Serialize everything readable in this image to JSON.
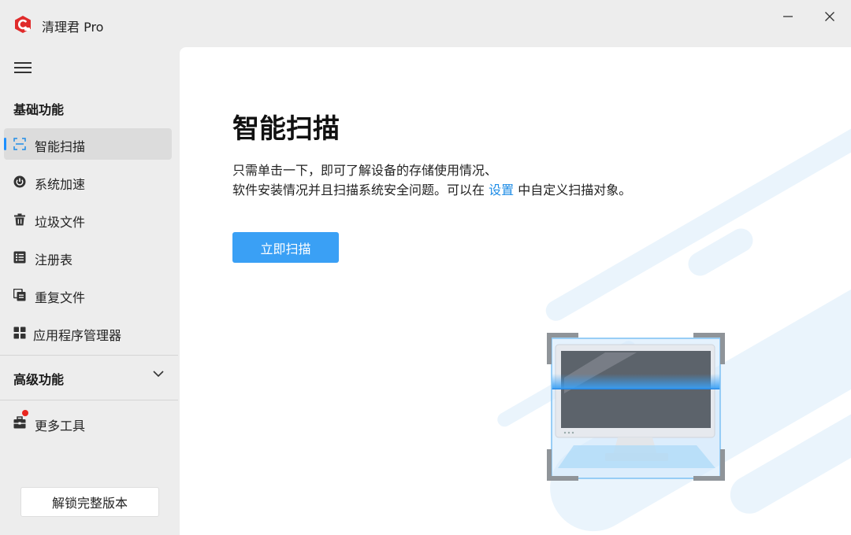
{
  "app": {
    "title": "清理君 Pro",
    "window_controls": {
      "minimize_icon": "minimize-icon",
      "close_icon": "close-icon"
    }
  },
  "sidebar": {
    "menu_icon": "hamburger-icon",
    "basic_section": "基础功能",
    "items": [
      {
        "label": "智能扫描",
        "icon": "scan-frame-icon",
        "active": true
      },
      {
        "label": "系统加速",
        "icon": "power-icon"
      },
      {
        "label": "垃圾文件",
        "icon": "trash-icon"
      },
      {
        "label": "注册表",
        "icon": "list-icon"
      },
      {
        "label": "重复文件",
        "icon": "duplicate-icon"
      },
      {
        "label": "应用程序管理器",
        "icon": "grid-icon"
      }
    ],
    "advanced_section": "高级功能",
    "more_tools": "更多工具",
    "unlock_button": "解锁完整版本"
  },
  "main": {
    "title": "智能扫描",
    "desc_line1": "只需单击一下，即可了解设备的存储使用情况、",
    "desc_line2_before": "软件安装情况并且扫描系统安全问题。可以在 ",
    "desc_link": "设置",
    "desc_line2_after": " 中自定义扫描对象。",
    "scan_button": "立即扫描"
  },
  "colors": {
    "accent": "#3aa0f5",
    "link": "#1e8ce6",
    "indicator": "#1e90ff",
    "badge": "#e8261f",
    "sidebar_bg": "#ededed"
  }
}
